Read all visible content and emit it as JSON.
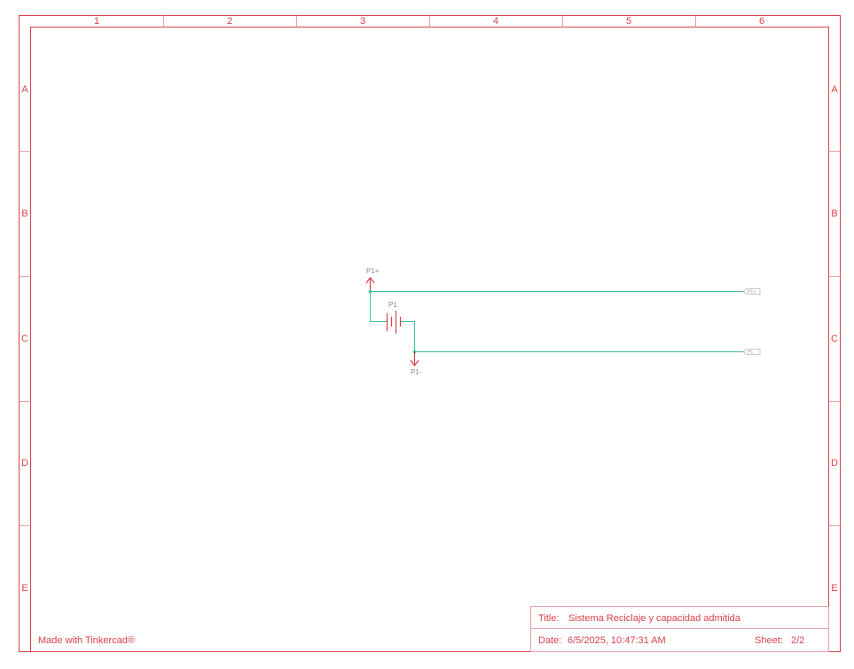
{
  "frame": {
    "columns": [
      "1",
      "2",
      "3",
      "4",
      "5",
      "6"
    ],
    "rows": [
      "A",
      "B",
      "C",
      "D",
      "E"
    ]
  },
  "schematic": {
    "battery_ref": "P1",
    "positive_net_label": "P1+",
    "negative_net_label": "P1-",
    "port_positive_label": "P1+",
    "port_negative_label": "P1-"
  },
  "footer": {
    "made_with": "Made with Tinkercad®"
  },
  "title_block": {
    "title_label": "Title:",
    "title_value": "Sistema Reciclaje y capacidad admitida",
    "date_label": "Date:",
    "date_value": "6/5/2025, 10:47:31 AM",
    "sheet_label": "Sheet:",
    "sheet_value": "2/2"
  },
  "colors": {
    "frame": "#d9414a",
    "wire": "#36c29d",
    "reference_text": "#8a8a8a"
  }
}
